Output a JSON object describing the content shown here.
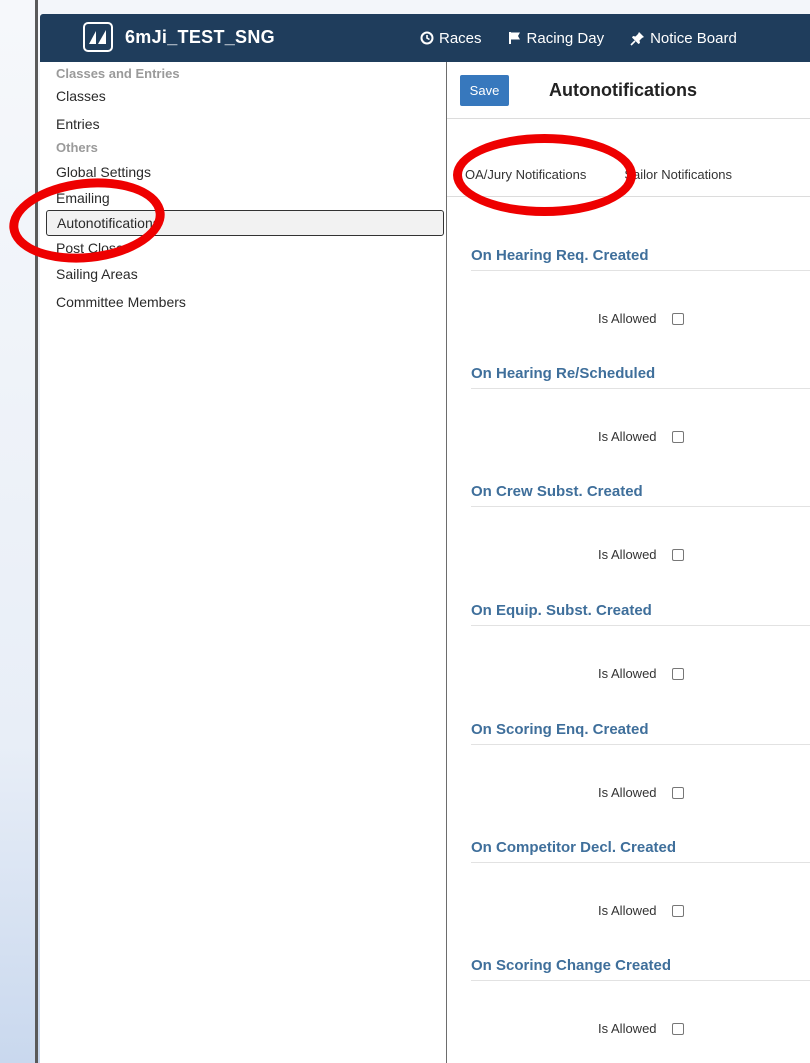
{
  "app": {
    "title": "6mJi_TEST_SNG",
    "nav": [
      {
        "label": "Races",
        "icon": "clock-icon"
      },
      {
        "label": "Racing Day",
        "icon": "flag-icon"
      },
      {
        "label": "Notice Board",
        "icon": "pin-icon"
      }
    ]
  },
  "sidebar": {
    "groups": [
      {
        "header": "Classes and Entries",
        "items": [
          "Classes",
          "Entries"
        ]
      },
      {
        "header": "Others",
        "items": [
          "Global Settings",
          "Emailing",
          "Autonotifications",
          "Post Close",
          "Sailing Areas",
          "Committee Members"
        ]
      }
    ],
    "active_item": "Autonotifications"
  },
  "main": {
    "save_label": "Save",
    "title": "Autonotifications",
    "tabs": [
      "OA/Jury Notifications",
      "Sailor Notifications"
    ],
    "active_tab": "OA/Jury Notifications",
    "sections": [
      {
        "title": "On Hearing Req. Created",
        "label": "Is Allowed",
        "checked": false
      },
      {
        "title": "On Hearing Re/Scheduled",
        "label": "Is Allowed",
        "checked": false
      },
      {
        "title": "On Crew Subst. Created",
        "label": "Is Allowed",
        "checked": false
      },
      {
        "title": "On Equip. Subst. Created",
        "label": "Is Allowed",
        "checked": false
      },
      {
        "title": "On Scoring Enq. Created",
        "label": "Is Allowed",
        "checked": false
      },
      {
        "title": "On Competitor Decl. Created",
        "label": "Is Allowed",
        "checked": false
      },
      {
        "title": "On Scoring Change Created",
        "label": "Is Allowed",
        "checked": false
      }
    ]
  },
  "colors": {
    "topbar": "#1f3d5c",
    "accent": "#3778bd",
    "section_title": "#3f6f9b",
    "annotation": "#ee0000"
  }
}
